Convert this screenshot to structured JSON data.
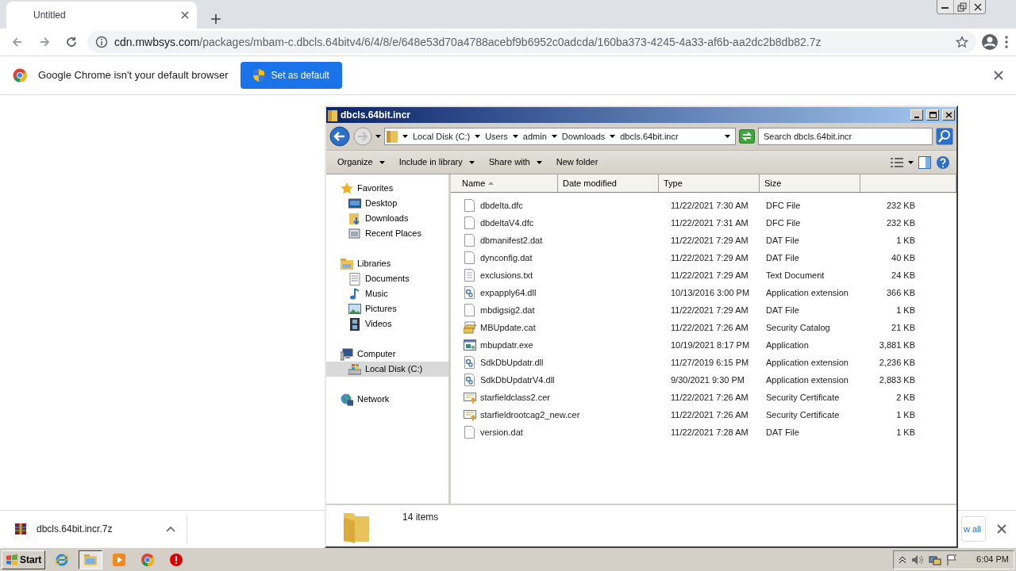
{
  "browser": {
    "tab": {
      "title": "Untitled"
    },
    "address": {
      "host": "cdn.mwbsys.com",
      "path": "/packages/mbam-c.dbcls.64bitv4/6/4/8/e/648e53d70a4788acebf9b6952c0adcda/160ba373-4245-4a33-af6b-aa2dc2b8db82.7z"
    }
  },
  "infobar": {
    "message": "Google Chrome isn't your default browser",
    "button": "Set as default"
  },
  "explorer": {
    "title": "dbcls.64bit.incr",
    "breadcrumb": [
      "Local Disk (C:)",
      "Users",
      "admin",
      "Downloads",
      "dbcls.64bit.incr"
    ],
    "search": {
      "placeholder": "Search dbcls.64bit.incr"
    },
    "toolbar": [
      {
        "label": "Organize",
        "dropdown": true
      },
      {
        "label": "Include in library",
        "dropdown": true
      },
      {
        "label": "Share with",
        "dropdown": true
      },
      {
        "label": "New folder",
        "dropdown": false
      }
    ],
    "nav": [
      {
        "label": "Favorites",
        "kind": "favorites",
        "selected": false,
        "children": [
          {
            "label": "Desktop",
            "kind": "desktop",
            "selected": false
          },
          {
            "label": "Downloads",
            "kind": "downloads",
            "selected": false
          },
          {
            "label": "Recent Places",
            "kind": "recent",
            "selected": false
          }
        ]
      },
      {
        "label": "Libraries",
        "kind": "libraries",
        "selected": false,
        "children": [
          {
            "label": "Documents",
            "kind": "documents",
            "selected": false
          },
          {
            "label": "Music",
            "kind": "music",
            "selected": false
          },
          {
            "label": "Pictures",
            "kind": "pictures",
            "selected": false
          },
          {
            "label": "Videos",
            "kind": "videos",
            "selected": false
          }
        ]
      },
      {
        "label": "Computer",
        "kind": "computer",
        "selected": false,
        "children": [
          {
            "label": "Local Disk (C:)",
            "kind": "disk",
            "selected": true
          }
        ]
      },
      {
        "label": "Network",
        "kind": "network",
        "selected": false
      }
    ],
    "columns": [
      {
        "label": "Name",
        "sorted": true
      },
      {
        "label": "Date modified",
        "sorted": false
      },
      {
        "label": "Type",
        "sorted": false
      },
      {
        "label": "Size",
        "sorted": false
      }
    ],
    "rows": [
      {
        "name": "dbdelta.dfc",
        "date": "11/22/2021 7:30 AM",
        "type": "DFC File",
        "size": "232 KB",
        "kind": "blank"
      },
      {
        "name": "dbdeltaV4.dfc",
        "date": "11/22/2021 7:31 AM",
        "type": "DFC File",
        "size": "232 KB",
        "kind": "blank"
      },
      {
        "name": "dbmanifest2.dat",
        "date": "11/22/2021 7:29 AM",
        "type": "DAT File",
        "size": "1 KB",
        "kind": "blank"
      },
      {
        "name": "dynconfig.dat",
        "date": "11/22/2021 7:29 AM",
        "type": "DAT File",
        "size": "40 KB",
        "kind": "blank"
      },
      {
        "name": "exclusions.txt",
        "date": "11/22/2021 7:29 AM",
        "type": "Text Document",
        "size": "24 KB",
        "kind": "text"
      },
      {
        "name": "expapply64.dll",
        "date": "10/13/2016 3:00 PM",
        "type": "Application extension",
        "size": "366 KB",
        "kind": "dll"
      },
      {
        "name": "mbdigsig2.dat",
        "date": "11/22/2021 7:29 AM",
        "type": "DAT File",
        "size": "1 KB",
        "kind": "blank"
      },
      {
        "name": "MBUpdate.cat",
        "date": "11/22/2021 7:26 AM",
        "type": "Security Catalog",
        "size": "21 KB",
        "kind": "catalog"
      },
      {
        "name": "mbupdatr.exe",
        "date": "10/19/2021 8:17 PM",
        "type": "Application",
        "size": "3,881 KB",
        "kind": "exe"
      },
      {
        "name": "SdkDbUpdatr.dll",
        "date": "11/27/2019 6:15 PM",
        "type": "Application extension",
        "size": "2,236 KB",
        "kind": "dll"
      },
      {
        "name": "SdkDbUpdatrV4.dll",
        "date": "9/30/2021 9:30 PM",
        "type": "Application extension",
        "size": "2,883 KB",
        "kind": "dll"
      },
      {
        "name": "starfieldclass2.cer",
        "date": "11/22/2021 7:26 AM",
        "type": "Security Certificate",
        "size": "2 KB",
        "kind": "cert"
      },
      {
        "name": "starfieldrootcag2_new.cer",
        "date": "11/22/2021 7:26 AM",
        "type": "Security Certificate",
        "size": "1 KB",
        "kind": "cert"
      },
      {
        "name": "version.dat",
        "date": "11/22/2021 7:28 AM",
        "type": "DAT File",
        "size": "1 KB",
        "kind": "blank"
      }
    ],
    "status": "14 items"
  },
  "downloads": {
    "file": "dbcls.64bit.incr.7z",
    "show_all": "w all"
  },
  "taskbar": {
    "start": "Start",
    "apps": [
      {
        "kind": "ie",
        "active": false
      },
      {
        "kind": "explorer",
        "active": true
      },
      {
        "kind": "media",
        "active": false
      },
      {
        "kind": "chrome",
        "active": false
      },
      {
        "kind": "stop",
        "active": false
      }
    ],
    "clock": "6:04 PM"
  }
}
